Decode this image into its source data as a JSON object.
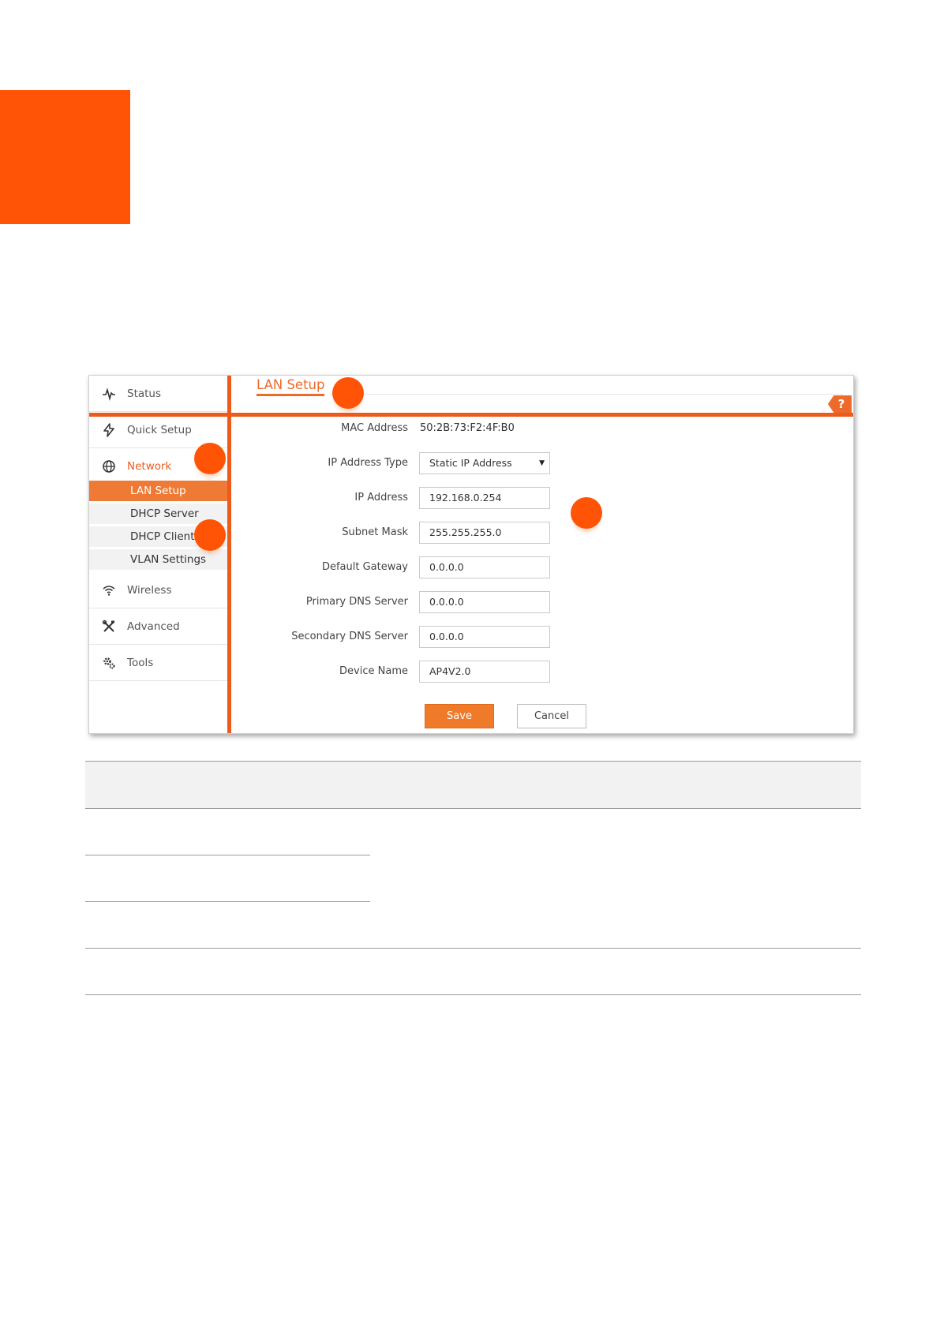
{
  "sidebar": {
    "items": [
      {
        "label": "Status",
        "icon": "pulse-icon"
      },
      {
        "label": "Quick Setup",
        "icon": "lightning-icon"
      },
      {
        "label": "Network",
        "icon": "globe-icon"
      },
      {
        "label": "Wireless",
        "icon": "wifi-icon"
      },
      {
        "label": "Advanced",
        "icon": "tools-icon"
      },
      {
        "label": "Tools",
        "icon": "gears-icon"
      }
    ],
    "network_sub": [
      "LAN Setup",
      "DHCP Server",
      "DHCP Client",
      "VLAN Settings"
    ],
    "selected": "LAN Setup"
  },
  "page": {
    "tab_title": "LAN Setup",
    "help_label": "?"
  },
  "form": {
    "mac_label": "MAC Address",
    "mac_value": "50:2B:73:F2:4F:B0",
    "ip_type_label": "IP Address Type",
    "ip_type_value": "Static IP Address",
    "ip_label": "IP Address",
    "ip_value": "192.168.0.254",
    "mask_label": "Subnet Mask",
    "mask_value": "255.255.255.0",
    "gateway_label": "Default Gateway",
    "gateway_value": "0.0.0.0",
    "dns1_label": "Primary DNS Server",
    "dns1_value": "0.0.0.0",
    "dns2_label": "Secondary DNS Server",
    "dns2_value": "0.0.0.0",
    "device_label": "Device Name",
    "device_value": "AP4V2.0"
  },
  "buttons": {
    "save": "Save",
    "cancel": "Cancel"
  },
  "colors": {
    "accent": "#ee5a1a",
    "marker": "#ff5405"
  }
}
